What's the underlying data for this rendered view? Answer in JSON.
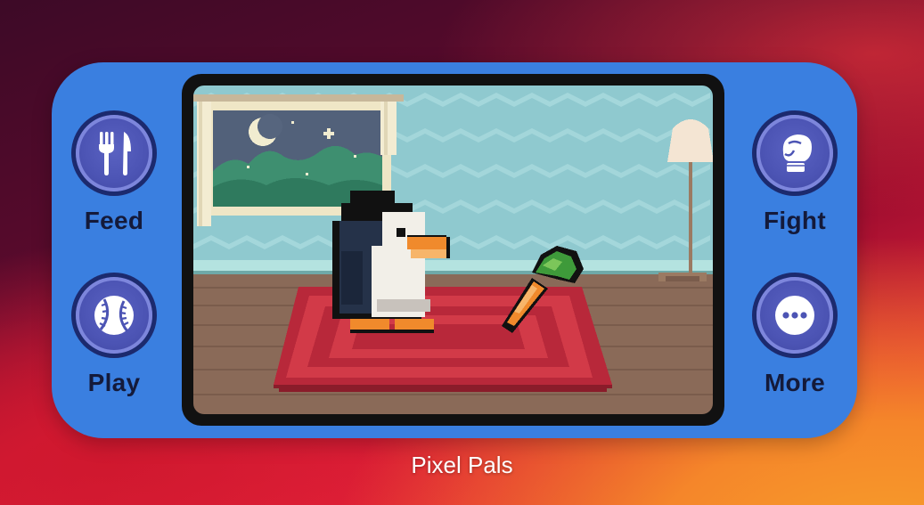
{
  "widget": {
    "app_name": "Pixel Pals",
    "left_actions": [
      {
        "label": "Feed",
        "icon": "fork-knife-icon"
      },
      {
        "label": "Play",
        "icon": "baseball-icon"
      }
    ],
    "right_actions": [
      {
        "label": "Fight",
        "icon": "boxing-glove-icon"
      },
      {
        "label": "More",
        "icon": "ellipsis-icon"
      }
    ],
    "colors": {
      "widget_background": "#3a7fe0",
      "button_fill": "#4c54b4",
      "button_ring": "#1c2a6e",
      "label_text": "#141a3a"
    }
  }
}
